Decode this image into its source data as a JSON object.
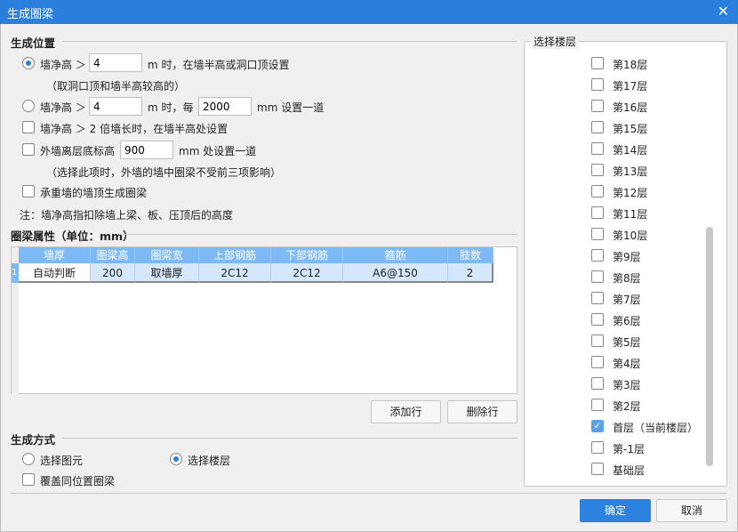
{
  "window": {
    "title": "生成圈梁",
    "close": "✕"
  },
  "position": {
    "title": "生成位置",
    "opt1": {
      "label": "墙净高 ＞",
      "value": "4",
      "suffix": "m 时，在墙半高或洞口顶设置",
      "note": "（取洞口顶和墙半高较高的）",
      "selected": true
    },
    "opt2": {
      "label": "墙净高 ＞",
      "value": "4",
      "mid": "m 时，每",
      "value2": "2000",
      "suffix": "mm 设置一道",
      "selected": false
    },
    "opt3": {
      "label": "墙净高 ＞ 2 倍墙长时，在墙半高处设置",
      "checked": false
    },
    "opt4": {
      "label": "外墙离层底标高",
      "value": "900",
      "suffix": "mm 处设置一道",
      "note": "（选择此项时，外墙的墙中圈梁不受前三项影响）",
      "checked": false
    },
    "opt5": {
      "label": "承重墙的墙顶生成圈梁",
      "checked": false
    },
    "note": "注：墙净高指扣除墙上梁、板、压顶后的高度"
  },
  "props": {
    "title": "圈梁属性（单位：mm）",
    "columns": [
      "墙厚",
      "圈梁高",
      "圈梁宽",
      "上部钢筋",
      "下部钢筋",
      "箍筋",
      "肢数"
    ],
    "rows": [
      {
        "index": "1",
        "cells": [
          "自动判断",
          "200",
          "取墙厚",
          "2C12",
          "2C12",
          "A6@150",
          "2"
        ]
      }
    ],
    "add_row": "添加行",
    "delete_row": "删除行"
  },
  "method": {
    "title": "生成方式",
    "opt_elements": "选择图元",
    "opt_floors": "选择楼层",
    "selected": "选择楼层",
    "cover": "覆盖同位置圈梁",
    "cover_checked": false
  },
  "floors": {
    "title": "选择楼层",
    "items": [
      {
        "label": "第18层",
        "checked": false
      },
      {
        "label": "第17层",
        "checked": false
      },
      {
        "label": "第16层",
        "checked": false
      },
      {
        "label": "第15层",
        "checked": false
      },
      {
        "label": "第14层",
        "checked": false
      },
      {
        "label": "第13层",
        "checked": false
      },
      {
        "label": "第12层",
        "checked": false
      },
      {
        "label": "第11层",
        "checked": false
      },
      {
        "label": "第10层",
        "checked": false
      },
      {
        "label": "第9层",
        "checked": false
      },
      {
        "label": "第8层",
        "checked": false
      },
      {
        "label": "第7层",
        "checked": false
      },
      {
        "label": "第6层",
        "checked": false
      },
      {
        "label": "第5层",
        "checked": false
      },
      {
        "label": "第4层",
        "checked": false
      },
      {
        "label": "第3层",
        "checked": false
      },
      {
        "label": "第2层",
        "checked": false
      },
      {
        "label": "首层（当前楼层）",
        "checked": true
      },
      {
        "label": "第-1层",
        "checked": false
      },
      {
        "label": "基础层",
        "checked": false
      }
    ]
  },
  "footer": {
    "ok": "确定",
    "cancel": "取消"
  },
  "colors": {
    "accent": "#2b7fdc",
    "header": "#7db9f4",
    "row": "#d5e8fb"
  }
}
